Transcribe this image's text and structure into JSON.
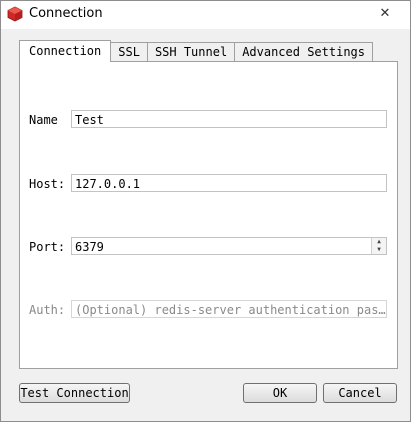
{
  "window": {
    "title": "Connection",
    "close_glyph": "✕",
    "icon": "redis-desktop-icon"
  },
  "tabs": [
    {
      "label": "Connection",
      "active": true
    },
    {
      "label": "SSL",
      "active": false
    },
    {
      "label": "SSH Tunnel",
      "active": false
    },
    {
      "label": "Advanced Settings",
      "active": false
    }
  ],
  "form": {
    "name": {
      "label": "Name",
      "value": "Test"
    },
    "host": {
      "label": "Host:",
      "value": "127.0.0.1"
    },
    "port": {
      "label": "Port:",
      "value": "6379"
    },
    "auth": {
      "label": "Auth:",
      "placeholder": "(Optional) redis-server authentication pas…"
    }
  },
  "buttons": {
    "test_connection": "Test Connection",
    "ok": "OK",
    "cancel": "Cancel"
  },
  "colors": {
    "icon_red": "#d0282a",
    "panel_bg": "#ffffff",
    "dialog_bg": "#f0f0f0"
  }
}
